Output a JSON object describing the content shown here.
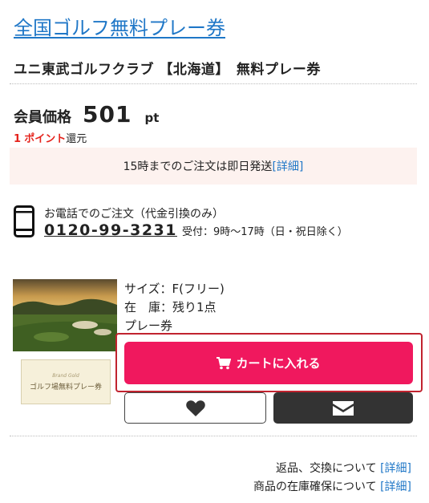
{
  "category": {
    "label": "全国ゴルフ無料プレー券"
  },
  "product": {
    "title": "ユニ東武ゴルフクラブ 【北海道】　無料プレー券"
  },
  "price": {
    "label": "会員価格",
    "value": "501",
    "unit": "pt"
  },
  "points": {
    "amount": "1",
    "unit": "ポイント",
    "suffix": "還元"
  },
  "shipping": {
    "text": "15時までのご注文は即日発送 ",
    "detail_link": "[詳細]"
  },
  "phone": {
    "icon": "smartphone-icon",
    "order_text": "お電話でのご注文（代金引換のみ）",
    "number": "0120-99-3231",
    "hours": "受付：9時〜17時（日・祝日除く）"
  },
  "specs": {
    "size": "サイズ：F(フリー)",
    "stock": "在　庫：残り1点",
    "type": "プレー券"
  },
  "voucher_image": {
    "line1": "Brand Gold",
    "line2": "ゴルフ場無料プレー券"
  },
  "buttons": {
    "cart_label": "カートに入れる",
    "cart_icon": "cart-icon",
    "favorite_icon": "heart-icon",
    "mail_icon": "envelope-icon"
  },
  "footer": {
    "returns_text": "返品、交換について ",
    "returns_link": "[詳細]",
    "stock_text": "商品の在庫確保について ",
    "stock_link": "[詳細]"
  },
  "colors": {
    "link": "#1f77c7",
    "points_red": "#e5231c",
    "cart_pink": "#f0185e",
    "highlight_frame": "#c1232f",
    "shipping_bg": "#fdf2ef"
  }
}
